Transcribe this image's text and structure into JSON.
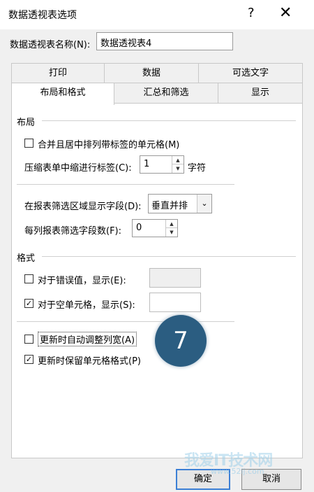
{
  "window": {
    "title": "数据透视表选项",
    "help": "?",
    "close": "✕"
  },
  "name_label": "数据透视表名称(N):",
  "name_value": "数据透视表4",
  "tabs_top": [
    "打印",
    "数据",
    "可选文字"
  ],
  "tabs_bottom": [
    "布局和格式",
    "汇总和筛选",
    "显示"
  ],
  "layout": {
    "section_title": "布局",
    "merge_center": {
      "label": "合并且居中排列带标签的单元格(M)",
      "checked": false
    },
    "indent_label": "压缩表单中缩进行标签(C):",
    "indent_value": "1",
    "indent_unit": "字符",
    "filter_area_label": "在报表筛选区域显示字段(D):",
    "filter_area_value": "垂直并排",
    "filter_count_label": "每列报表筛选字段数(F):",
    "filter_count_value": "0"
  },
  "format": {
    "section_title": "格式",
    "error_values": {
      "label": "对于错误值，显示(E):",
      "checked": false
    },
    "empty_cells": {
      "label": "对于空单元格，显示(S):",
      "checked": true
    },
    "autofit": {
      "label": "更新时自动调整列宽(A)",
      "checked": false
    },
    "preserve": {
      "label": "更新时保留单元格格式(P)",
      "checked": true
    }
  },
  "step_badge": "7",
  "buttons": {
    "ok": "确定",
    "cancel": "取消"
  },
  "watermark": {
    "main": "我爱IT技术网",
    "sub": "www.52ij.com"
  }
}
